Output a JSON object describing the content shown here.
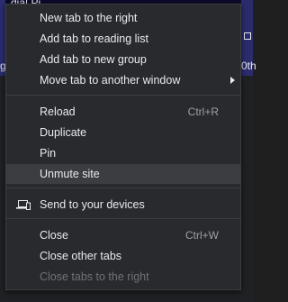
{
  "background": {
    "left_text": "g",
    "top_text": "dia| Pi",
    "top_right_glyph": "X",
    "right_text": "0th"
  },
  "menu": {
    "groups": [
      [
        {
          "label": "New tab to the right",
          "name": "menu-item-new-tab-right"
        },
        {
          "label": "Add tab to reading list",
          "name": "menu-item-add-reading-list"
        },
        {
          "label": "Add tab to new group",
          "name": "menu-item-add-new-group"
        },
        {
          "label": "Move tab to another window",
          "name": "menu-item-move-tab",
          "submenu": true
        }
      ],
      [
        {
          "label": "Reload",
          "shortcut": "Ctrl+R",
          "name": "menu-item-reload"
        },
        {
          "label": "Duplicate",
          "name": "menu-item-duplicate"
        },
        {
          "label": "Pin",
          "name": "menu-item-pin"
        },
        {
          "label": "Unmute site",
          "name": "menu-item-unmute-site",
          "highlighted": true
        }
      ],
      [
        {
          "label": "Send to your devices",
          "name": "menu-item-send-to-devices",
          "icon": "devices-icon"
        }
      ],
      [
        {
          "label": "Close",
          "shortcut": "Ctrl+W",
          "name": "menu-item-close"
        },
        {
          "label": "Close other tabs",
          "name": "menu-item-close-other-tabs"
        },
        {
          "label": "Close tabs to the right",
          "name": "menu-item-close-tabs-right",
          "disabled": true
        }
      ]
    ]
  },
  "colors": {
    "menu_bg": "#292a2d",
    "highlight": "#3c3d40",
    "text": "#e8eaed",
    "disabled_text": "#6f7175",
    "shortcut_text": "#9aa0a6"
  }
}
